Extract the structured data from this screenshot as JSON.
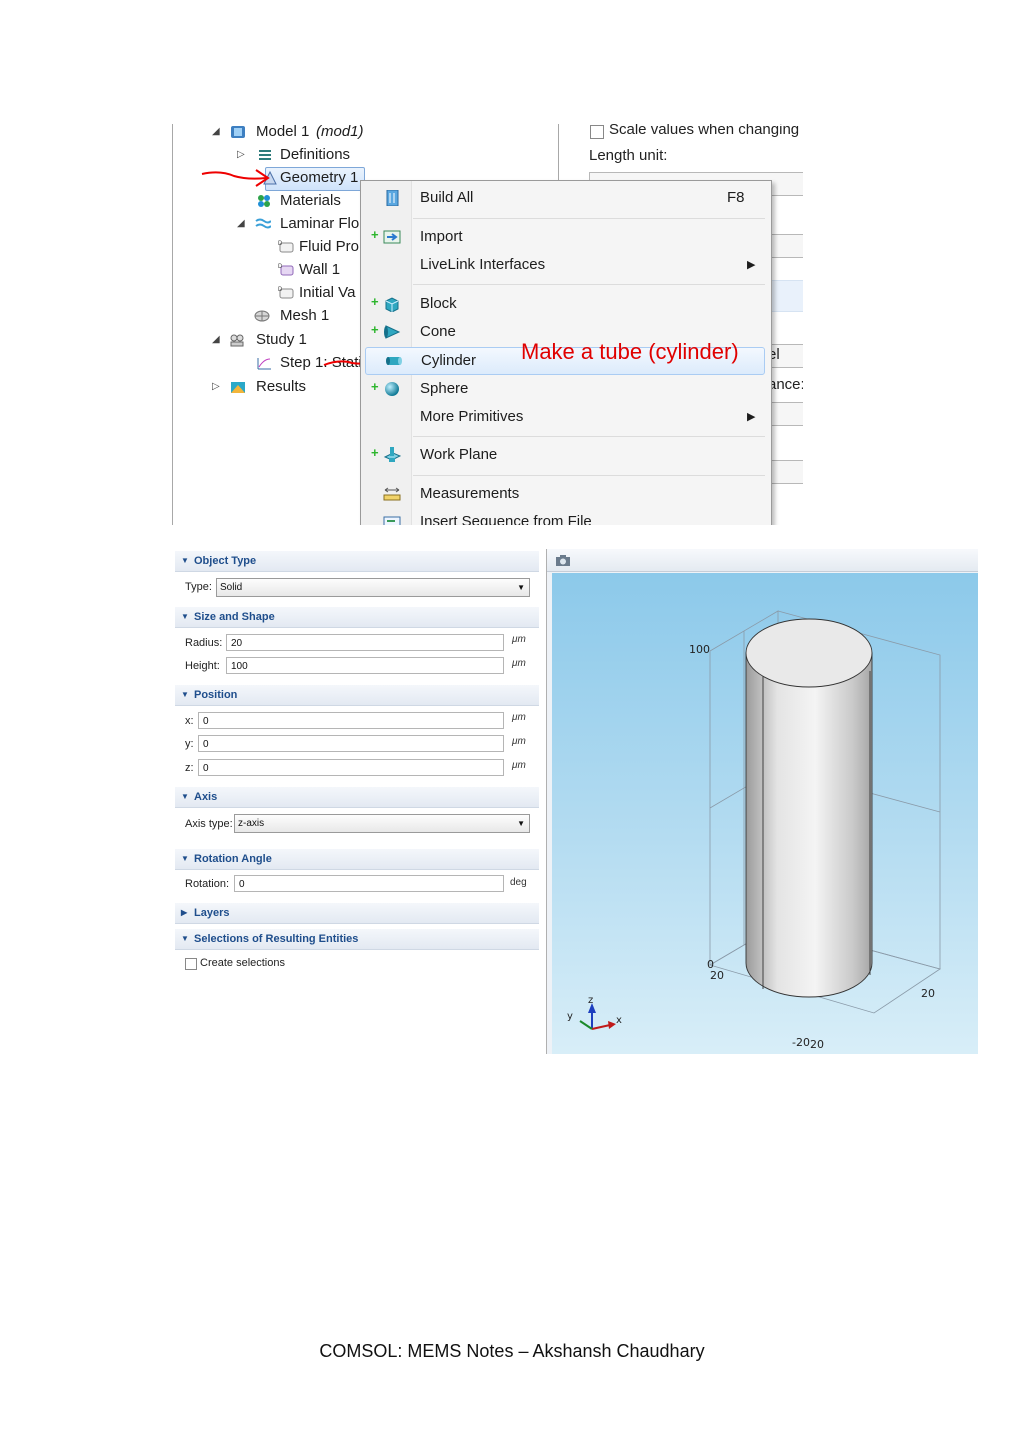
{
  "tree": {
    "model": "Model 1",
    "model_tag": "(mod1)",
    "definitions": "Definitions",
    "geometry": "Geometry 1",
    "materials": "Materials",
    "laminar_flow": "Laminar Flo",
    "fluid_props": "Fluid Pro",
    "wall": "Wall 1",
    "initial_values": "Initial Va",
    "mesh": "Mesh 1",
    "study": "Study 1",
    "step": "Step 1: Stati",
    "results": "Results"
  },
  "right_pane": {
    "scale_values": "Scale values when changing",
    "length_unit": "Length unit:",
    "partial_el": "el",
    "partial_ance": "ance:"
  },
  "context_menu": {
    "items": [
      {
        "label": "Build All",
        "shortcut": "F8",
        "icon": "build-all-icon"
      },
      {
        "label": "Import",
        "icon": "import-icon"
      },
      {
        "label": "LiveLink Interfaces",
        "submenu": true
      },
      {
        "label": "Block",
        "icon": "block-icon"
      },
      {
        "label": "Cone",
        "icon": "cone-icon"
      },
      {
        "label": "Cylinder",
        "icon": "cylinder-icon",
        "highlighted": true
      },
      {
        "label": "Sphere",
        "icon": "sphere-icon"
      },
      {
        "label": "More Primitives",
        "submenu": true
      },
      {
        "label": "Work Plane",
        "icon": "work-plane-icon"
      },
      {
        "label": "Measurements",
        "icon": "ruler-icon"
      },
      {
        "label": "Insert Sequence from File",
        "icon": "insert-sequence-icon"
      }
    ]
  },
  "annotation": "Make a tube (cylinder)",
  "settings": {
    "object_type": {
      "title": "Object Type",
      "type_label": "Type:",
      "type_value": "Solid"
    },
    "size_shape": {
      "title": "Size and Shape",
      "radius_label": "Radius:",
      "radius": "20",
      "height_label": "Height:",
      "height": "100",
      "unit": "μm"
    },
    "position": {
      "title": "Position",
      "x_label": "x:",
      "x": "0",
      "y_label": "y:",
      "y": "0",
      "z_label": "z:",
      "z": "0",
      "unit": "μm"
    },
    "axis": {
      "title": "Axis",
      "axis_type_label": "Axis type:",
      "axis_type": "z-axis"
    },
    "rotation": {
      "title": "Rotation Angle",
      "rotation_label": "Rotation:",
      "rotation": "0",
      "unit": "deg"
    },
    "layers": {
      "title": "Layers"
    },
    "selections": {
      "title": "Selections of Resulting Entities",
      "create_label": "Create selections",
      "create_checked": false
    }
  },
  "graphics": {
    "toolbar_icon": "camera-icon",
    "tick_100": "100",
    "tick_0": "0",
    "tick_20_left": "20",
    "tick_20_right": "20",
    "tick_neg20": "-20",
    "tick_20_bottom": "20",
    "axis_y": "y",
    "axis_z": "z",
    "axis_x": "x",
    "colors": {
      "background_top": "#8cc9ea",
      "background_bottom": "#d8eef8",
      "cylinder": "#d9d9d9"
    }
  },
  "footer": "COMSOL: MEMS Notes – Akshansh Chaudhary"
}
